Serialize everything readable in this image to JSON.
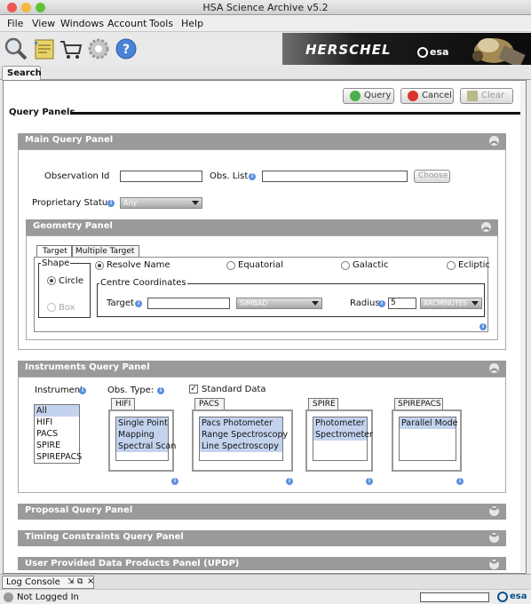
{
  "window": {
    "title": "HSA Science Archive v5.2"
  },
  "menubar": {
    "items": [
      "File",
      "View",
      "Windows",
      "Account",
      "Tools",
      "Help"
    ]
  },
  "toolbar": {
    "icons": [
      "search-icon",
      "notes-icon",
      "cart-icon",
      "settings-gear-icon",
      "help-icon"
    ]
  },
  "banner": {
    "mission": "HERSCHEL",
    "agency": "esa"
  },
  "tabs": {
    "search": "Search"
  },
  "actions": {
    "query": "Query",
    "cancel": "Cancel",
    "clear": "Clear"
  },
  "query_panels": {
    "title": "Query Panels"
  },
  "main_panel": {
    "title": "Main Query Panel",
    "observation_id_label": "Observation Id",
    "obs_list_label": "Obs. List",
    "choose_label": "Choose",
    "proprietary_status_label": "Proprietary Status",
    "proprietary_status_value": "Any"
  },
  "geometry_panel": {
    "title": "Geometry Panel",
    "tabs": [
      "Target",
      "Multiple Target"
    ],
    "shape_label": "Shape",
    "shape_options": [
      "Circle",
      "Box"
    ],
    "resolve_options": [
      "Resolve Name",
      "Equatorial",
      "Galactic",
      "Ecliptic"
    ],
    "centre_coordinates_label": "Centre Coordinates",
    "target_label": "Target",
    "resolver_value": "SIMBAD",
    "radius_label": "Radius",
    "radius_value": "5",
    "radius_unit": "ARCMINUTES"
  },
  "instruments_panel": {
    "title": "Instruments Query Panel",
    "instrument_label": "Instrument",
    "instruments": [
      "All",
      "HIFI",
      "PACS",
      "SPIRE",
      "SPIREPACS"
    ],
    "obs_type_label": "Obs. Type:",
    "standard_data_label": "Standard Data",
    "groups": [
      {
        "name": "HIFI",
        "items": [
          "Single Point",
          "Mapping",
          "Spectral Scan"
        ]
      },
      {
        "name": "PACS",
        "items": [
          "Pacs Photometer",
          "Range Spectroscopy",
          "Line Spectroscopy"
        ]
      },
      {
        "name": "SPIRE",
        "items": [
          "Photometer",
          "Spectrometer"
        ]
      },
      {
        "name": "SPIREPACS",
        "items": [
          "Parallel Mode"
        ]
      }
    ]
  },
  "collapsed_panels": {
    "proposal": "Proposal Query Panel",
    "timing": "Timing Constraints Query Panel",
    "updp": "User Provided Data Products Panel (UPDP)"
  },
  "log_console": {
    "label": "Log Console"
  },
  "status": {
    "login": "Not Logged In",
    "agency": "esa"
  },
  "colors": {
    "panel_header": "#9a9a9a",
    "selection": "#c3d3ee",
    "info_icon": "#5b8fe0"
  }
}
